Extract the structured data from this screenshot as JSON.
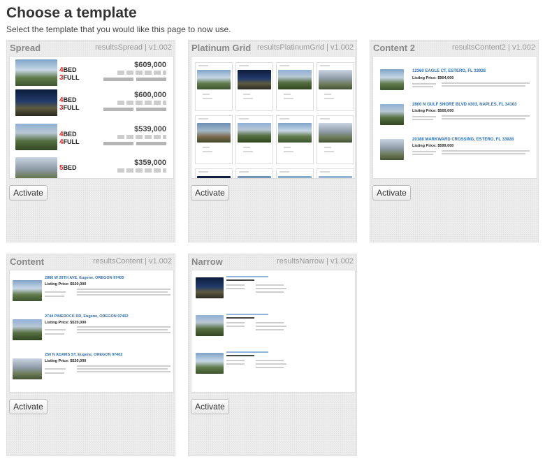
{
  "page": {
    "title": "Choose a template",
    "subtitle": "Select the template that you would like this page to now use."
  },
  "templates": [
    {
      "name": "Spread",
      "meta": "resultsSpread | v1.002",
      "activate_label": "Activate",
      "preview": {
        "listings": [
          {
            "price": "$609,000",
            "beds": "4",
            "beds_label": "BED",
            "baths": "3",
            "baths_label": "FULL",
            "photo": "ph-a"
          },
          {
            "price": "$600,000",
            "beds": "4",
            "beds_label": "BED",
            "baths": "3",
            "baths_label": "FULL",
            "photo": "ph-b"
          },
          {
            "price": "$539,000",
            "beds": "4",
            "beds_label": "BED",
            "baths": "4",
            "baths_label": "FULL",
            "photo": "ph-c"
          },
          {
            "price": "$359,000",
            "beds": "5",
            "beds_label": "BED",
            "baths": "",
            "baths_label": "",
            "photo": "ph-d"
          }
        ]
      }
    },
    {
      "name": "Platinum Grid",
      "meta": "resultsPlatinumGrid | v1.002",
      "activate_label": "Activate"
    },
    {
      "name": "Content 2",
      "meta": "resultsContent2 | v1.002",
      "activate_label": "Activate",
      "preview": {
        "listings": [
          {
            "address": "12360 EAGLE CT, ESTERO, FL 33928",
            "price": "Listing Price: $904,000"
          },
          {
            "address": "2800 N GULF SHORE BLVD #303, NAPLES, FL 34103",
            "price": "Listing Price: $500,000"
          },
          {
            "address": "20188 MARKWARD CROSSING, ESTERO, FL 33928",
            "price": "Listing Price: $599,000"
          }
        ]
      }
    },
    {
      "name": "Content",
      "meta": "resultsContent | v1.002",
      "activate_label": "Activate",
      "preview": {
        "listings": [
          {
            "address": "2880 W 29TH AVE, Eugene, OREGON 97405",
            "price": "Listing Price: $520,000"
          },
          {
            "address": "2744 PINEROCK DR, Eugene, OREGON 97402",
            "price": "Listing Price: $520,000"
          },
          {
            "address": "250 N ADAMS ST, Eugene, OREGON 97402",
            "price": "Listing Price: $520,000"
          }
        ]
      }
    },
    {
      "name": "Narrow",
      "meta": "resultsNarrow | v1.002",
      "activate_label": "Activate"
    }
  ],
  "colors": {
    "accent_red": "#e22222",
    "link_blue": "#2a6db5",
    "card_bg": "#ececec"
  }
}
